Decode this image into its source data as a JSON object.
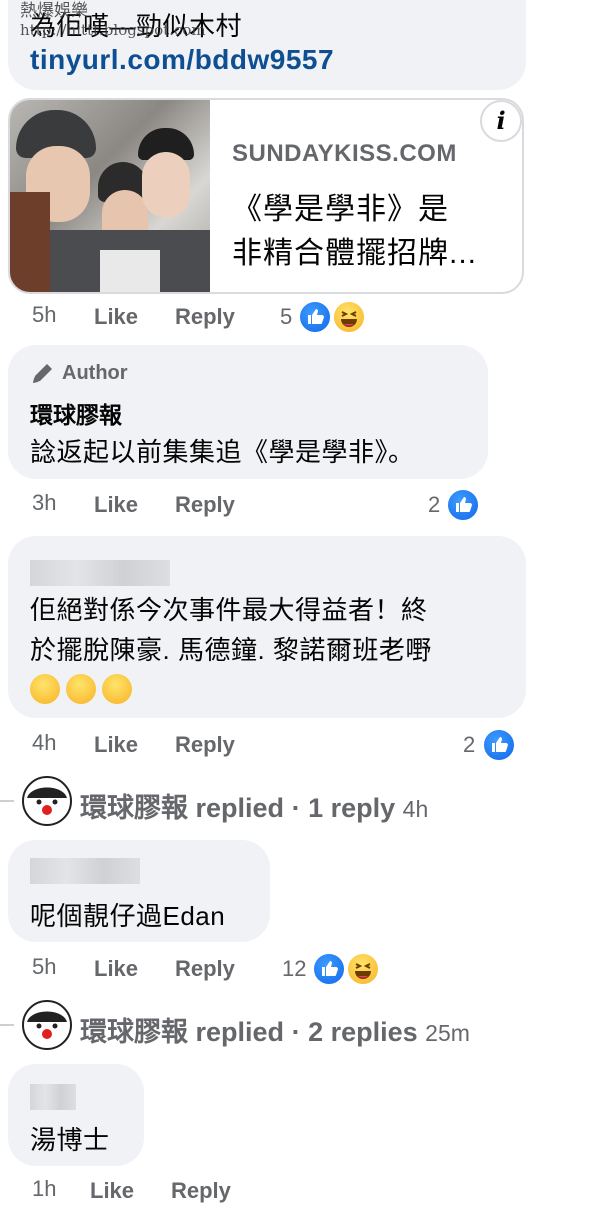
{
  "watermark": {
    "line1": "熱爆娛樂",
    "line2": "http://hittt.blogspot.com"
  },
  "comment1": {
    "text_top": "為佢嘆—勁似木村",
    "link": "tinyurl.com/bddw9557",
    "preview": {
      "domain": "SUNDAYKISS.COM",
      "title_line1": "《學是學非》是",
      "title_line2": "非精合體擺招牌..."
    },
    "time": "5h",
    "like": "Like",
    "reply": "Reply",
    "reaction_count": "5"
  },
  "comment2": {
    "badge": "Author",
    "author": "環球膠報",
    "text": "諗返起以前集集追《學是學非》。",
    "time": "3h",
    "like": "Like",
    "reply": "Reply",
    "reaction_count": "2"
  },
  "comment3": {
    "text_line1": "佢絕對係今次事件最大得益者！終",
    "text_line2": "於擺脫陳豪. 馬德鐘. 黎諾爾班老嘢",
    "time": "4h",
    "like": "Like",
    "reply": "Reply",
    "reaction_count": "2"
  },
  "replies1": {
    "name": "環球膠報",
    "action": "replied",
    "count": "1 reply",
    "time": "4h"
  },
  "comment4": {
    "text": "呢個靚仔過Edan",
    "time": "5h",
    "like": "Like",
    "reply": "Reply",
    "reaction_count": "12"
  },
  "replies2": {
    "name": "環球膠報",
    "action": "replied",
    "count": "2 replies",
    "time": "25m"
  },
  "comment5": {
    "text": "湯博士",
    "time": "1h",
    "like": "Like",
    "reply": "Reply"
  },
  "colors": {
    "like_blue": "#1877f2",
    "bubble": "#f0f2f5",
    "meta": "#65676b"
  },
  "icons": [
    "like-icon",
    "haha-icon",
    "info-icon",
    "pencil-icon",
    "laughing-emoji"
  ]
}
